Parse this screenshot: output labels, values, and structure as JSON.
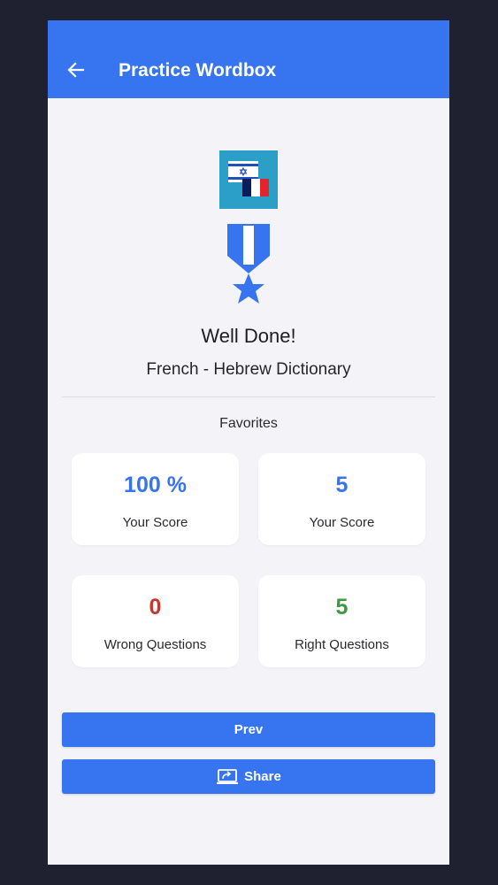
{
  "appbar": {
    "title": "Practice Wordbox",
    "back_icon": "arrow-left-icon",
    "color": "#3774ef"
  },
  "result": {
    "badge_icon": "israel-france-flags-icon",
    "medal_icon": "medal-star-icon",
    "headline": "Well Done!",
    "dictionary": "French - Hebrew Dictionary",
    "section": "Favorites"
  },
  "stats": [
    {
      "value": "100 %",
      "label": "Your Score",
      "color": "#3774ef"
    },
    {
      "value": "5",
      "label": "Your Score",
      "color": "#3774ef"
    },
    {
      "value": "0",
      "label": "Wrong Questions",
      "color": "#c8372d"
    },
    {
      "value": "5",
      "label": "Right Questions",
      "color": "#3d9a3f"
    }
  ],
  "actions": {
    "prev_label": "Prev",
    "share_label": "Share",
    "share_icon": "share-screen-icon"
  }
}
